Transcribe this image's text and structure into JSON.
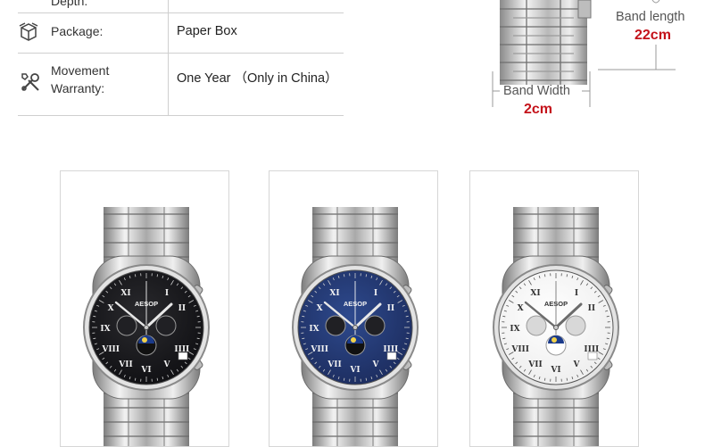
{
  "specs": {
    "depth_label": "Depth:",
    "package_label": "Package:",
    "package_value": "Paper Box",
    "warranty_label_line1": "Movement",
    "warranty_label_line2": "Warranty:",
    "warranty_value": "One Year （Only in China）"
  },
  "dimensions": {
    "band_length_label": "Band length",
    "band_length_value": "22cm",
    "band_width_label": "Band Width",
    "band_width_value": "2cm"
  },
  "watches": [
    {
      "variant": "black",
      "dial_color": "#0d0d10",
      "brand": "AESOP"
    },
    {
      "variant": "blue",
      "dial_color": "#1b2a5a",
      "brand": "AESOP"
    },
    {
      "variant": "white",
      "dial_color": "#ececec",
      "brand": "AESOP"
    }
  ],
  "colors": {
    "accent": "#c4121a"
  }
}
